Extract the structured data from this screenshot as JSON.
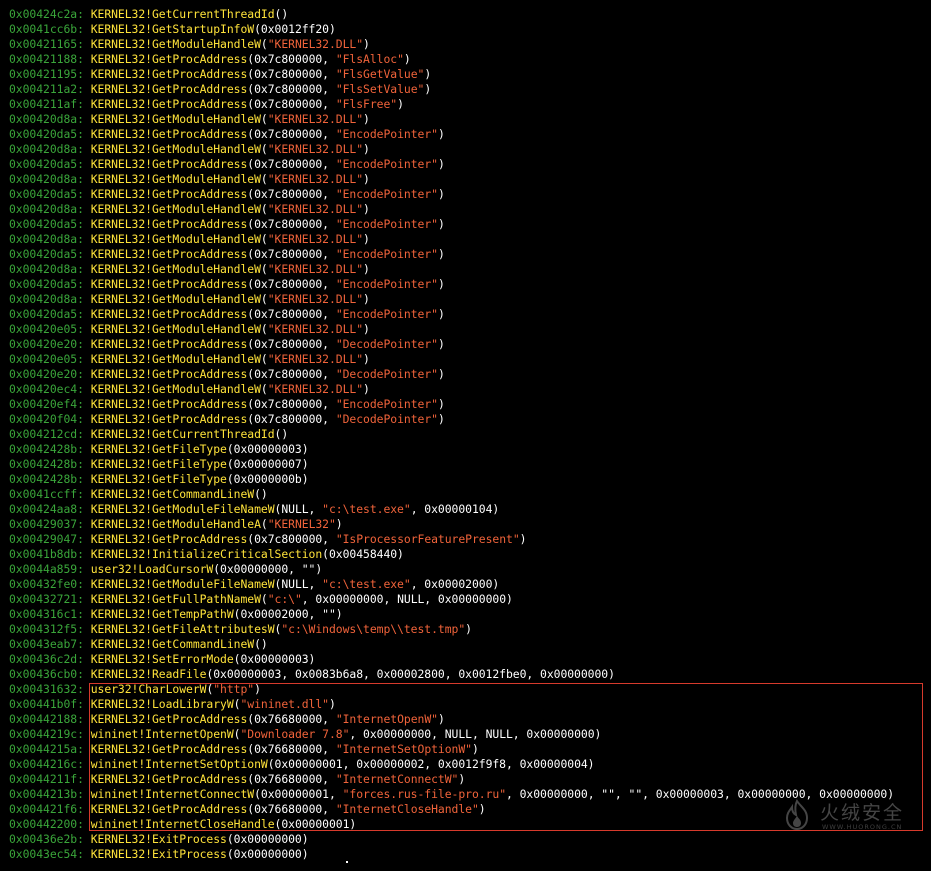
{
  "colors": {
    "background": "#000000",
    "address": "#3aa63a",
    "api_call": "#ffe33a",
    "arguments": "#ffffff",
    "string_literal": "#f0633a",
    "highlight_border": "#d63a2c"
  },
  "lines": [
    {
      "addr": "0x00424c2a",
      "sep": ": ",
      "parts": [
        {
          "t": "mod",
          "v": "KERNEL32!GetCurrentThreadId"
        },
        {
          "t": "args",
          "v": "()"
        }
      ]
    },
    {
      "addr": "0x0041cc6b",
      "sep": ": ",
      "parts": [
        {
          "t": "mod",
          "v": "KERNEL32!GetStartupInfoW"
        },
        {
          "t": "args",
          "v": "(0x0012ff20)"
        }
      ]
    },
    {
      "addr": "0x00421165",
      "sep": ": ",
      "parts": [
        {
          "t": "mod",
          "v": "KERNEL32!GetModuleHandleW"
        },
        {
          "t": "args",
          "v": "("
        },
        {
          "t": "str",
          "v": "\"KERNEL32.DLL\""
        },
        {
          "t": "args",
          "v": ")"
        }
      ]
    },
    {
      "addr": "0x00421188",
      "sep": ": ",
      "parts": [
        {
          "t": "mod",
          "v": "KERNEL32!GetProcAddress"
        },
        {
          "t": "args",
          "v": "(0x7c800000, "
        },
        {
          "t": "str",
          "v": "\"FlsAlloc\""
        },
        {
          "t": "args",
          "v": ")"
        }
      ]
    },
    {
      "addr": "0x00421195",
      "sep": ": ",
      "parts": [
        {
          "t": "mod",
          "v": "KERNEL32!GetProcAddress"
        },
        {
          "t": "args",
          "v": "(0x7c800000, "
        },
        {
          "t": "str",
          "v": "\"FlsGetValue\""
        },
        {
          "t": "args",
          "v": ")"
        }
      ]
    },
    {
      "addr": "0x004211a2",
      "sep": ": ",
      "parts": [
        {
          "t": "mod",
          "v": "KERNEL32!GetProcAddress"
        },
        {
          "t": "args",
          "v": "(0x7c800000, "
        },
        {
          "t": "str",
          "v": "\"FlsSetValue\""
        },
        {
          "t": "args",
          "v": ")"
        }
      ]
    },
    {
      "addr": "0x004211af",
      "sep": ": ",
      "parts": [
        {
          "t": "mod",
          "v": "KERNEL32!GetProcAddress"
        },
        {
          "t": "args",
          "v": "(0x7c800000, "
        },
        {
          "t": "str",
          "v": "\"FlsFree\""
        },
        {
          "t": "args",
          "v": ")"
        }
      ]
    },
    {
      "addr": "0x00420d8a",
      "sep": ": ",
      "parts": [
        {
          "t": "mod",
          "v": "KERNEL32!GetModuleHandleW"
        },
        {
          "t": "args",
          "v": "("
        },
        {
          "t": "str",
          "v": "\"KERNEL32.DLL\""
        },
        {
          "t": "args",
          "v": ")"
        }
      ]
    },
    {
      "addr": "0x00420da5",
      "sep": ": ",
      "parts": [
        {
          "t": "mod",
          "v": "KERNEL32!GetProcAddress"
        },
        {
          "t": "args",
          "v": "(0x7c800000, "
        },
        {
          "t": "str",
          "v": "\"EncodePointer\""
        },
        {
          "t": "args",
          "v": ")"
        }
      ]
    },
    {
      "addr": "0x00420d8a",
      "sep": ": ",
      "parts": [
        {
          "t": "mod",
          "v": "KERNEL32!GetModuleHandleW"
        },
        {
          "t": "args",
          "v": "("
        },
        {
          "t": "str",
          "v": "\"KERNEL32.DLL\""
        },
        {
          "t": "args",
          "v": ")"
        }
      ]
    },
    {
      "addr": "0x00420da5",
      "sep": ": ",
      "parts": [
        {
          "t": "mod",
          "v": "KERNEL32!GetProcAddress"
        },
        {
          "t": "args",
          "v": "(0x7c800000, "
        },
        {
          "t": "str",
          "v": "\"EncodePointer\""
        },
        {
          "t": "args",
          "v": ")"
        }
      ]
    },
    {
      "addr": "0x00420d8a",
      "sep": ": ",
      "parts": [
        {
          "t": "mod",
          "v": "KERNEL32!GetModuleHandleW"
        },
        {
          "t": "args",
          "v": "("
        },
        {
          "t": "str",
          "v": "\"KERNEL32.DLL\""
        },
        {
          "t": "args",
          "v": ")"
        }
      ]
    },
    {
      "addr": "0x00420da5",
      "sep": ": ",
      "parts": [
        {
          "t": "mod",
          "v": "KERNEL32!GetProcAddress"
        },
        {
          "t": "args",
          "v": "(0x7c800000, "
        },
        {
          "t": "str",
          "v": "\"EncodePointer\""
        },
        {
          "t": "args",
          "v": ")"
        }
      ]
    },
    {
      "addr": "0x00420d8a",
      "sep": ": ",
      "parts": [
        {
          "t": "mod",
          "v": "KERNEL32!GetModuleHandleW"
        },
        {
          "t": "args",
          "v": "("
        },
        {
          "t": "str",
          "v": "\"KERNEL32.DLL\""
        },
        {
          "t": "args",
          "v": ")"
        }
      ]
    },
    {
      "addr": "0x00420da5",
      "sep": ": ",
      "parts": [
        {
          "t": "mod",
          "v": "KERNEL32!GetProcAddress"
        },
        {
          "t": "args",
          "v": "(0x7c800000, "
        },
        {
          "t": "str",
          "v": "\"EncodePointer\""
        },
        {
          "t": "args",
          "v": ")"
        }
      ]
    },
    {
      "addr": "0x00420d8a",
      "sep": ": ",
      "parts": [
        {
          "t": "mod",
          "v": "KERNEL32!GetModuleHandleW"
        },
        {
          "t": "args",
          "v": "("
        },
        {
          "t": "str",
          "v": "\"KERNEL32.DLL\""
        },
        {
          "t": "args",
          "v": ")"
        }
      ]
    },
    {
      "addr": "0x00420da5",
      "sep": ": ",
      "parts": [
        {
          "t": "mod",
          "v": "KERNEL32!GetProcAddress"
        },
        {
          "t": "args",
          "v": "(0x7c800000, "
        },
        {
          "t": "str",
          "v": "\"EncodePointer\""
        },
        {
          "t": "args",
          "v": ")"
        }
      ]
    },
    {
      "addr": "0x00420d8a",
      "sep": ": ",
      "parts": [
        {
          "t": "mod",
          "v": "KERNEL32!GetModuleHandleW"
        },
        {
          "t": "args",
          "v": "("
        },
        {
          "t": "str",
          "v": "\"KERNEL32.DLL\""
        },
        {
          "t": "args",
          "v": ")"
        }
      ]
    },
    {
      "addr": "0x00420da5",
      "sep": ": ",
      "parts": [
        {
          "t": "mod",
          "v": "KERNEL32!GetProcAddress"
        },
        {
          "t": "args",
          "v": "(0x7c800000, "
        },
        {
          "t": "str",
          "v": "\"EncodePointer\""
        },
        {
          "t": "args",
          "v": ")"
        }
      ]
    },
    {
      "addr": "0x00420d8a",
      "sep": ": ",
      "parts": [
        {
          "t": "mod",
          "v": "KERNEL32!GetModuleHandleW"
        },
        {
          "t": "args",
          "v": "("
        },
        {
          "t": "str",
          "v": "\"KERNEL32.DLL\""
        },
        {
          "t": "args",
          "v": ")"
        }
      ]
    },
    {
      "addr": "0x00420da5",
      "sep": ": ",
      "parts": [
        {
          "t": "mod",
          "v": "KERNEL32!GetProcAddress"
        },
        {
          "t": "args",
          "v": "(0x7c800000, "
        },
        {
          "t": "str",
          "v": "\"EncodePointer\""
        },
        {
          "t": "args",
          "v": ")"
        }
      ]
    },
    {
      "addr": "0x00420e05",
      "sep": ": ",
      "parts": [
        {
          "t": "mod",
          "v": "KERNEL32!GetModuleHandleW"
        },
        {
          "t": "args",
          "v": "("
        },
        {
          "t": "str",
          "v": "\"KERNEL32.DLL\""
        },
        {
          "t": "args",
          "v": ")"
        }
      ]
    },
    {
      "addr": "0x00420e20",
      "sep": ": ",
      "parts": [
        {
          "t": "mod",
          "v": "KERNEL32!GetProcAddress"
        },
        {
          "t": "args",
          "v": "(0x7c800000, "
        },
        {
          "t": "str",
          "v": "\"DecodePointer\""
        },
        {
          "t": "args",
          "v": ")"
        }
      ]
    },
    {
      "addr": "0x00420e05",
      "sep": ": ",
      "parts": [
        {
          "t": "mod",
          "v": "KERNEL32!GetModuleHandleW"
        },
        {
          "t": "args",
          "v": "("
        },
        {
          "t": "str",
          "v": "\"KERNEL32.DLL\""
        },
        {
          "t": "args",
          "v": ")"
        }
      ]
    },
    {
      "addr": "0x00420e20",
      "sep": ": ",
      "parts": [
        {
          "t": "mod",
          "v": "KERNEL32!GetProcAddress"
        },
        {
          "t": "args",
          "v": "(0x7c800000, "
        },
        {
          "t": "str",
          "v": "\"DecodePointer\""
        },
        {
          "t": "args",
          "v": ")"
        }
      ]
    },
    {
      "addr": "0x00420ec4",
      "sep": ": ",
      "parts": [
        {
          "t": "mod",
          "v": "KERNEL32!GetModuleHandleW"
        },
        {
          "t": "args",
          "v": "("
        },
        {
          "t": "str",
          "v": "\"KERNEL32.DLL\""
        },
        {
          "t": "args",
          "v": ")"
        }
      ]
    },
    {
      "addr": "0x00420ef4",
      "sep": ": ",
      "parts": [
        {
          "t": "mod",
          "v": "KERNEL32!GetProcAddress"
        },
        {
          "t": "args",
          "v": "(0x7c800000, "
        },
        {
          "t": "str",
          "v": "\"EncodePointer\""
        },
        {
          "t": "args",
          "v": ")"
        }
      ]
    },
    {
      "addr": "0x00420f04",
      "sep": ": ",
      "parts": [
        {
          "t": "mod",
          "v": "KERNEL32!GetProcAddress"
        },
        {
          "t": "args",
          "v": "(0x7c800000, "
        },
        {
          "t": "str",
          "v": "\"DecodePointer\""
        },
        {
          "t": "args",
          "v": ")"
        }
      ]
    },
    {
      "addr": "0x004212cd",
      "sep": ": ",
      "parts": [
        {
          "t": "mod",
          "v": "KERNEL32!GetCurrentThreadId"
        },
        {
          "t": "args",
          "v": "()"
        }
      ]
    },
    {
      "addr": "0x0042428b",
      "sep": ": ",
      "parts": [
        {
          "t": "mod",
          "v": "KERNEL32!GetFileType"
        },
        {
          "t": "args",
          "v": "(0x00000003)"
        }
      ]
    },
    {
      "addr": "0x0042428b",
      "sep": ": ",
      "parts": [
        {
          "t": "mod",
          "v": "KERNEL32!GetFileType"
        },
        {
          "t": "args",
          "v": "(0x00000007)"
        }
      ]
    },
    {
      "addr": "0x0042428b",
      "sep": ": ",
      "parts": [
        {
          "t": "mod",
          "v": "KERNEL32!GetFileType"
        },
        {
          "t": "args",
          "v": "(0x0000000b)"
        }
      ]
    },
    {
      "addr": "0x0041ccff",
      "sep": ": ",
      "parts": [
        {
          "t": "mod",
          "v": "KERNEL32!GetCommandLineW"
        },
        {
          "t": "args",
          "v": "()"
        }
      ]
    },
    {
      "addr": "0x00424aa8",
      "sep": ": ",
      "parts": [
        {
          "t": "mod",
          "v": "KERNEL32!GetModuleFileNameW"
        },
        {
          "t": "args",
          "v": "(NULL, "
        },
        {
          "t": "str",
          "v": "\"c:\\test.exe\""
        },
        {
          "t": "args",
          "v": ", 0x00000104)"
        }
      ]
    },
    {
      "addr": "0x00429037",
      "sep": ": ",
      "parts": [
        {
          "t": "mod",
          "v": "KERNEL32!GetModuleHandleA"
        },
        {
          "t": "args",
          "v": "("
        },
        {
          "t": "str",
          "v": "\"KERNEL32\""
        },
        {
          "t": "args",
          "v": ")"
        }
      ]
    },
    {
      "addr": "0x00429047",
      "sep": ": ",
      "parts": [
        {
          "t": "mod",
          "v": "KERNEL32!GetProcAddress"
        },
        {
          "t": "args",
          "v": "(0x7c800000, "
        },
        {
          "t": "str",
          "v": "\"IsProcessorFeaturePresent\""
        },
        {
          "t": "args",
          "v": ")"
        }
      ]
    },
    {
      "addr": "0x0041b8db",
      "sep": ": ",
      "parts": [
        {
          "t": "mod",
          "v": "KERNEL32!InitializeCriticalSection"
        },
        {
          "t": "args",
          "v": "(0x00458440)"
        }
      ]
    },
    {
      "addr": "0x0044a859",
      "sep": ": ",
      "parts": [
        {
          "t": "mod",
          "v": "user32!LoadCursorW"
        },
        {
          "t": "args",
          "v": "(0x00000000, \"\")"
        }
      ]
    },
    {
      "addr": "0x00432fe0",
      "sep": ": ",
      "parts": [
        {
          "t": "mod",
          "v": "KERNEL32!GetModuleFileNameW"
        },
        {
          "t": "args",
          "v": "(NULL, "
        },
        {
          "t": "str",
          "v": "\"c:\\test.exe\""
        },
        {
          "t": "args",
          "v": ", 0x00002000)"
        }
      ]
    },
    {
      "addr": "0x00432721",
      "sep": ": ",
      "parts": [
        {
          "t": "mod",
          "v": "KERNEL32!GetFullPathNameW"
        },
        {
          "t": "args",
          "v": "("
        },
        {
          "t": "str",
          "v": "\"c:\\\""
        },
        {
          "t": "args",
          "v": ", 0x00000000, NULL, 0x00000000)"
        }
      ]
    },
    {
      "addr": "0x004316c1",
      "sep": ": ",
      "parts": [
        {
          "t": "mod",
          "v": "KERNEL32!GetTempPathW"
        },
        {
          "t": "args",
          "v": "(0x00002000, \"\")"
        }
      ]
    },
    {
      "addr": "0x004312f5",
      "sep": ": ",
      "parts": [
        {
          "t": "mod",
          "v": "KERNEL32!GetFileAttributesW"
        },
        {
          "t": "args",
          "v": "("
        },
        {
          "t": "str",
          "v": "\"c:\\Windows\\temp\\\\test.tmp\""
        },
        {
          "t": "args",
          "v": ")"
        }
      ]
    },
    {
      "addr": "0x0043eab7",
      "sep": ": ",
      "parts": [
        {
          "t": "mod",
          "v": "KERNEL32!GetCommandLineW"
        },
        {
          "t": "args",
          "v": "()"
        }
      ]
    },
    {
      "addr": "0x00436c2d",
      "sep": ": ",
      "parts": [
        {
          "t": "mod",
          "v": "KERNEL32!SetErrorMode"
        },
        {
          "t": "args",
          "v": "(0x00000003)"
        }
      ]
    },
    {
      "addr": "0x00436cb0",
      "sep": ": ",
      "parts": [
        {
          "t": "mod",
          "v": "KERNEL32!ReadFile"
        },
        {
          "t": "args",
          "v": "(0x00000003, 0x0083b6a8, 0x00002800, 0x0012fbe0, 0x00000000)"
        }
      ]
    },
    {
      "addr": "0x00431632",
      "sep": ": ",
      "parts": [
        {
          "t": "mod",
          "v": "user32!CharLowerW"
        },
        {
          "t": "args",
          "v": "("
        },
        {
          "t": "str",
          "v": "\"http\""
        },
        {
          "t": "args",
          "v": ")"
        }
      ]
    },
    {
      "addr": "0x00441b0f",
      "sep": ": ",
      "parts": [
        {
          "t": "mod",
          "v": "KERNEL32!LoadLibraryW"
        },
        {
          "t": "args",
          "v": "("
        },
        {
          "t": "str",
          "v": "\"wininet.dll\""
        },
        {
          "t": "args",
          "v": ")"
        }
      ]
    },
    {
      "addr": "0x00442188",
      "sep": ": ",
      "parts": [
        {
          "t": "mod",
          "v": "KERNEL32!GetProcAddress"
        },
        {
          "t": "args",
          "v": "(0x76680000, "
        },
        {
          "t": "str",
          "v": "\"InternetOpenW\""
        },
        {
          "t": "args",
          "v": ")"
        }
      ]
    },
    {
      "addr": "0x0044219c",
      "sep": ": ",
      "parts": [
        {
          "t": "mod",
          "v": "wininet!InternetOpenW"
        },
        {
          "t": "args",
          "v": "("
        },
        {
          "t": "str",
          "v": "\"Downloader 7.8\""
        },
        {
          "t": "args",
          "v": ", 0x00000000, NULL, NULL, 0x00000000)"
        }
      ]
    },
    {
      "addr": "0x0044215a",
      "sep": ": ",
      "parts": [
        {
          "t": "mod",
          "v": "KERNEL32!GetProcAddress"
        },
        {
          "t": "args",
          "v": "(0x76680000, "
        },
        {
          "t": "str",
          "v": "\"InternetSetOptionW\""
        },
        {
          "t": "args",
          "v": ")"
        }
      ]
    },
    {
      "addr": "0x0044216c",
      "sep": ": ",
      "parts": [
        {
          "t": "mod",
          "v": "wininet!InternetSetOptionW"
        },
        {
          "t": "args",
          "v": "(0x00000001, 0x00000002, 0x0012f9f8, 0x00000004)"
        }
      ]
    },
    {
      "addr": "0x0044211f",
      "sep": ": ",
      "parts": [
        {
          "t": "mod",
          "v": "KERNEL32!GetProcAddress"
        },
        {
          "t": "args",
          "v": "(0x76680000, "
        },
        {
          "t": "str",
          "v": "\"InternetConnectW\""
        },
        {
          "t": "args",
          "v": ")"
        }
      ]
    },
    {
      "addr": "0x0044213b",
      "sep": ": ",
      "parts": [
        {
          "t": "mod",
          "v": "wininet!InternetConnectW"
        },
        {
          "t": "args",
          "v": "(0x00000001, "
        },
        {
          "t": "str",
          "v": "\"forces.rus-file-pro.ru\""
        },
        {
          "t": "args",
          "v": ", 0x00000000, \"\", \"\", 0x00000003, 0x00000000, 0x00000000)"
        }
      ]
    },
    {
      "addr": "0x004421f6",
      "sep": ": ",
      "parts": [
        {
          "t": "mod",
          "v": "KERNEL32!GetProcAddress"
        },
        {
          "t": "args",
          "v": "(0x76680000, "
        },
        {
          "t": "str",
          "v": "\"InternetCloseHandle\""
        },
        {
          "t": "args",
          "v": ")"
        }
      ]
    },
    {
      "addr": "0x00442200",
      "sep": ": ",
      "parts": [
        {
          "t": "mod",
          "v": "wininet!InternetCloseHandle"
        },
        {
          "t": "args",
          "v": "(0x00000001)"
        }
      ]
    },
    {
      "addr": "0x00436e2b",
      "sep": ": ",
      "parts": [
        {
          "t": "mod",
          "v": "KERNEL32!ExitProcess"
        },
        {
          "t": "args",
          "v": "(0x00000000)"
        }
      ]
    },
    {
      "addr": "0x0043ec54",
      "sep": ": ",
      "parts": [
        {
          "t": "mod",
          "v": "KERNEL32!ExitProcess"
        },
        {
          "t": "args",
          "v": "(0x00000000)"
        }
      ]
    }
  ],
  "watermark": {
    "icon": "huorong-flame-icon",
    "text": "火绒安全",
    "url": "WWW.HUORONG.CN"
  }
}
